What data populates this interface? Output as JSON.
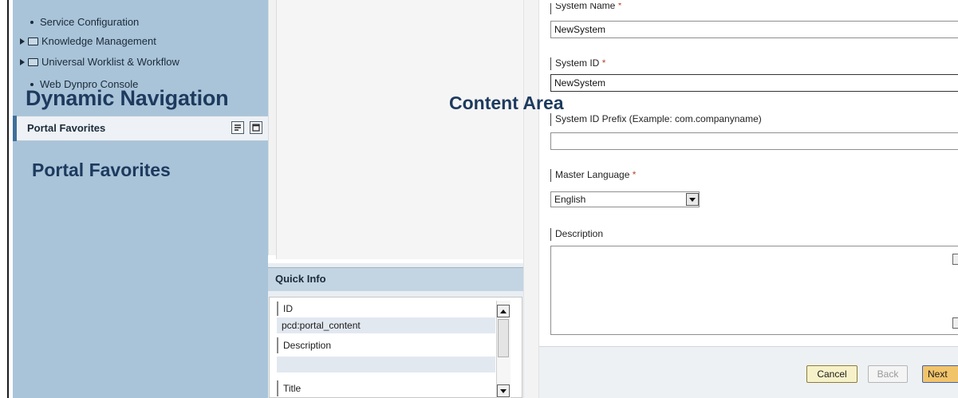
{
  "nav": {
    "items": [
      {
        "label": "Service Configuration"
      },
      {
        "label": "Knowledge Management"
      },
      {
        "label": "Universal Worklist & Workflow"
      },
      {
        "label": "Web Dynpro Console"
      }
    ]
  },
  "overlays": {
    "dynamic_navigation": "Dynamic Navigation",
    "portal_favorites": "Portal Favorites",
    "content_area": "Content Area"
  },
  "favorites": {
    "bar_title": "Portal Favorites"
  },
  "quick_info": {
    "title": "Quick Info",
    "rows": [
      {
        "label": "ID",
        "value": "pcd:portal_content"
      },
      {
        "label": "Description",
        "value": ""
      },
      {
        "label": "Title",
        "value": ""
      }
    ]
  },
  "form": {
    "system_name_label": "System Name",
    "system_name_value": "NewSystem",
    "system_id_label": "System ID",
    "system_id_value": "NewSystem",
    "system_id_prefix_label": "System ID Prefix (Example: com.companyname)",
    "system_id_prefix_value": "",
    "master_language_label": "Master Language",
    "master_language_value": "English",
    "description_label": "Description",
    "description_value": "",
    "required_marker": "*"
  },
  "footer": {
    "cancel_label": "Cancel",
    "back_label": "Back",
    "next_label": "Next"
  },
  "colors": {
    "nav_bg": "#a9c4d9",
    "overlay_text": "#1d3a5e",
    "next_btn": "#f2c46a",
    "cancel_btn": "#f7f1c9"
  }
}
